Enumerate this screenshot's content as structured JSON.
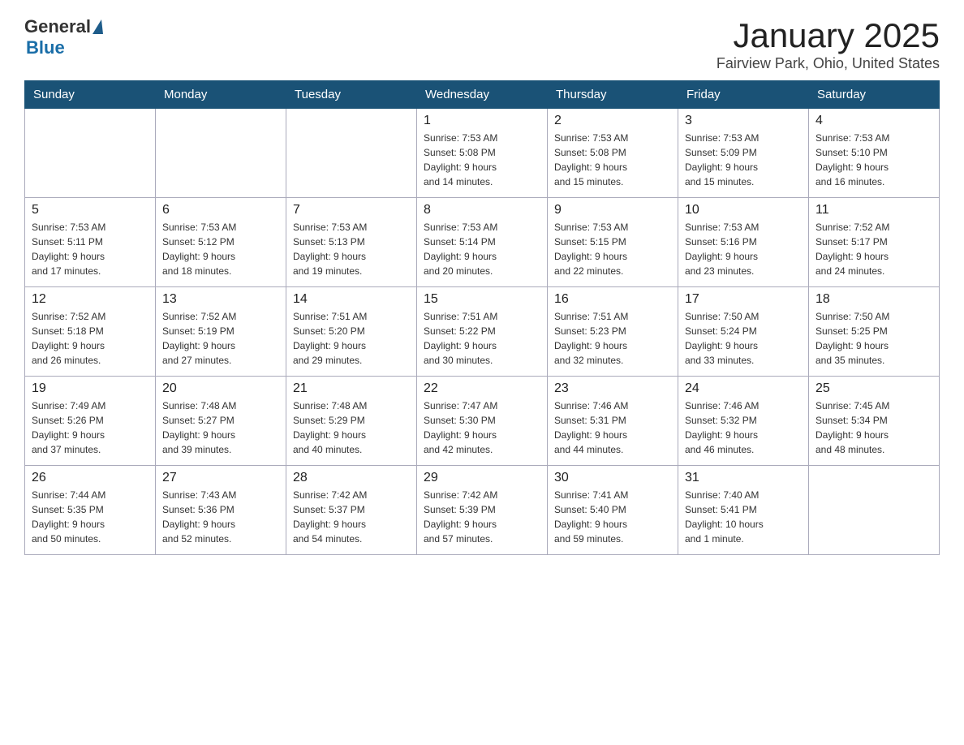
{
  "header": {
    "logo_general": "General",
    "logo_blue": "Blue",
    "title": "January 2025",
    "subtitle": "Fairview Park, Ohio, United States"
  },
  "calendar": {
    "days_of_week": [
      "Sunday",
      "Monday",
      "Tuesday",
      "Wednesday",
      "Thursday",
      "Friday",
      "Saturday"
    ],
    "weeks": [
      {
        "cells": [
          {
            "day": "",
            "info": ""
          },
          {
            "day": "",
            "info": ""
          },
          {
            "day": "",
            "info": ""
          },
          {
            "day": "1",
            "info": "Sunrise: 7:53 AM\nSunset: 5:08 PM\nDaylight: 9 hours\nand 14 minutes."
          },
          {
            "day": "2",
            "info": "Sunrise: 7:53 AM\nSunset: 5:08 PM\nDaylight: 9 hours\nand 15 minutes."
          },
          {
            "day": "3",
            "info": "Sunrise: 7:53 AM\nSunset: 5:09 PM\nDaylight: 9 hours\nand 15 minutes."
          },
          {
            "day": "4",
            "info": "Sunrise: 7:53 AM\nSunset: 5:10 PM\nDaylight: 9 hours\nand 16 minutes."
          }
        ]
      },
      {
        "cells": [
          {
            "day": "5",
            "info": "Sunrise: 7:53 AM\nSunset: 5:11 PM\nDaylight: 9 hours\nand 17 minutes."
          },
          {
            "day": "6",
            "info": "Sunrise: 7:53 AM\nSunset: 5:12 PM\nDaylight: 9 hours\nand 18 minutes."
          },
          {
            "day": "7",
            "info": "Sunrise: 7:53 AM\nSunset: 5:13 PM\nDaylight: 9 hours\nand 19 minutes."
          },
          {
            "day": "8",
            "info": "Sunrise: 7:53 AM\nSunset: 5:14 PM\nDaylight: 9 hours\nand 20 minutes."
          },
          {
            "day": "9",
            "info": "Sunrise: 7:53 AM\nSunset: 5:15 PM\nDaylight: 9 hours\nand 22 minutes."
          },
          {
            "day": "10",
            "info": "Sunrise: 7:53 AM\nSunset: 5:16 PM\nDaylight: 9 hours\nand 23 minutes."
          },
          {
            "day": "11",
            "info": "Sunrise: 7:52 AM\nSunset: 5:17 PM\nDaylight: 9 hours\nand 24 minutes."
          }
        ]
      },
      {
        "cells": [
          {
            "day": "12",
            "info": "Sunrise: 7:52 AM\nSunset: 5:18 PM\nDaylight: 9 hours\nand 26 minutes."
          },
          {
            "day": "13",
            "info": "Sunrise: 7:52 AM\nSunset: 5:19 PM\nDaylight: 9 hours\nand 27 minutes."
          },
          {
            "day": "14",
            "info": "Sunrise: 7:51 AM\nSunset: 5:20 PM\nDaylight: 9 hours\nand 29 minutes."
          },
          {
            "day": "15",
            "info": "Sunrise: 7:51 AM\nSunset: 5:22 PM\nDaylight: 9 hours\nand 30 minutes."
          },
          {
            "day": "16",
            "info": "Sunrise: 7:51 AM\nSunset: 5:23 PM\nDaylight: 9 hours\nand 32 minutes."
          },
          {
            "day": "17",
            "info": "Sunrise: 7:50 AM\nSunset: 5:24 PM\nDaylight: 9 hours\nand 33 minutes."
          },
          {
            "day": "18",
            "info": "Sunrise: 7:50 AM\nSunset: 5:25 PM\nDaylight: 9 hours\nand 35 minutes."
          }
        ]
      },
      {
        "cells": [
          {
            "day": "19",
            "info": "Sunrise: 7:49 AM\nSunset: 5:26 PM\nDaylight: 9 hours\nand 37 minutes."
          },
          {
            "day": "20",
            "info": "Sunrise: 7:48 AM\nSunset: 5:27 PM\nDaylight: 9 hours\nand 39 minutes."
          },
          {
            "day": "21",
            "info": "Sunrise: 7:48 AM\nSunset: 5:29 PM\nDaylight: 9 hours\nand 40 minutes."
          },
          {
            "day": "22",
            "info": "Sunrise: 7:47 AM\nSunset: 5:30 PM\nDaylight: 9 hours\nand 42 minutes."
          },
          {
            "day": "23",
            "info": "Sunrise: 7:46 AM\nSunset: 5:31 PM\nDaylight: 9 hours\nand 44 minutes."
          },
          {
            "day": "24",
            "info": "Sunrise: 7:46 AM\nSunset: 5:32 PM\nDaylight: 9 hours\nand 46 minutes."
          },
          {
            "day": "25",
            "info": "Sunrise: 7:45 AM\nSunset: 5:34 PM\nDaylight: 9 hours\nand 48 minutes."
          }
        ]
      },
      {
        "cells": [
          {
            "day": "26",
            "info": "Sunrise: 7:44 AM\nSunset: 5:35 PM\nDaylight: 9 hours\nand 50 minutes."
          },
          {
            "day": "27",
            "info": "Sunrise: 7:43 AM\nSunset: 5:36 PM\nDaylight: 9 hours\nand 52 minutes."
          },
          {
            "day": "28",
            "info": "Sunrise: 7:42 AM\nSunset: 5:37 PM\nDaylight: 9 hours\nand 54 minutes."
          },
          {
            "day": "29",
            "info": "Sunrise: 7:42 AM\nSunset: 5:39 PM\nDaylight: 9 hours\nand 57 minutes."
          },
          {
            "day": "30",
            "info": "Sunrise: 7:41 AM\nSunset: 5:40 PM\nDaylight: 9 hours\nand 59 minutes."
          },
          {
            "day": "31",
            "info": "Sunrise: 7:40 AM\nSunset: 5:41 PM\nDaylight: 10 hours\nand 1 minute."
          },
          {
            "day": "",
            "info": ""
          }
        ]
      }
    ]
  }
}
